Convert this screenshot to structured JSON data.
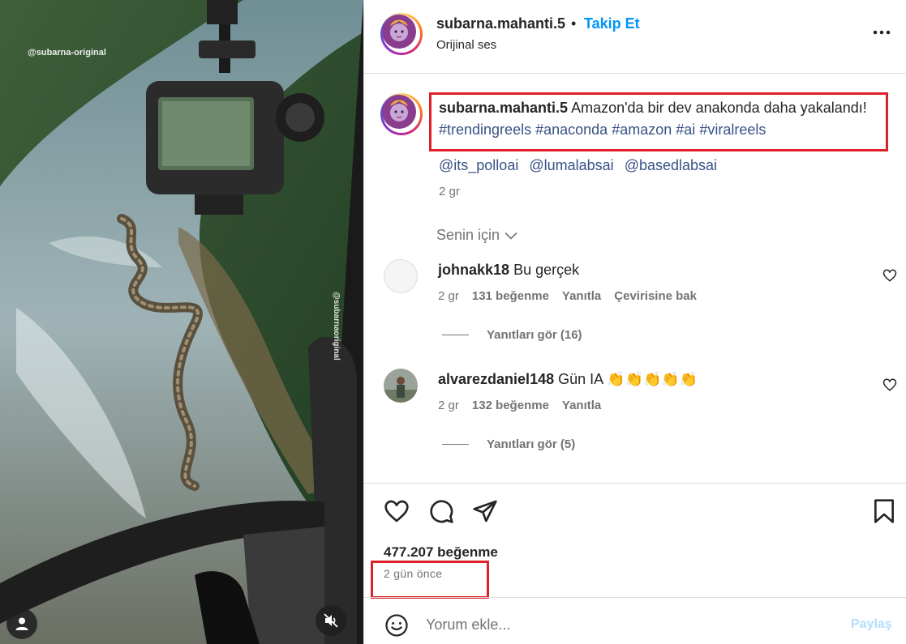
{
  "media": {
    "watermark_top": "@subarna-original",
    "watermark_side": "@subarnaoriginal",
    "icons": {
      "user": "user-icon",
      "mute": "speaker-muted-icon"
    }
  },
  "header": {
    "username": "subarna.mahanti.5",
    "separator": "•",
    "follow_label": "Takip Et",
    "audio_label": "Orijinal ses"
  },
  "caption": {
    "username": "subarna.mahanti.5",
    "text": "Amazon'da bir dev anakonda daha yakalandı!",
    "hashtags": [
      "#trendingreels",
      "#anaconda",
      "#amazon",
      "#ai",
      "#viralreels"
    ],
    "mentions": [
      "@its_polloai",
      "@lumalabsai",
      "@basedlabsai"
    ],
    "time": "2 gr"
  },
  "for_you_label": "Senin için",
  "comments": [
    {
      "username": "johnakk18",
      "text": "Bu gerçek",
      "time": "2 gr",
      "likes": "131 beğenme",
      "reply_label": "Yanıtla",
      "translate_label": "Çevirisine bak",
      "view_replies": "Yanıtları gör (16)"
    },
    {
      "username": "alvarezdaniel148",
      "text": "Gün IA 👏👏👏👏👏",
      "time": "2 gr",
      "likes": "132 beğenme",
      "reply_label": "Yanıtla",
      "view_replies": "Yanıtları gör (5)"
    }
  ],
  "actions": {
    "icons": [
      "heart-icon",
      "comment-icon",
      "share-icon",
      "bookmark-icon"
    ]
  },
  "likes_count": "477.207 beğenme",
  "posted_ago": "2 gün önce",
  "comment_box": {
    "placeholder": "Yorum ekle...",
    "share_label": "Paylaş"
  },
  "colors": {
    "accent": "#0095f6",
    "link": "#385185",
    "highlight": "#e0202a",
    "muted": "#737373"
  }
}
